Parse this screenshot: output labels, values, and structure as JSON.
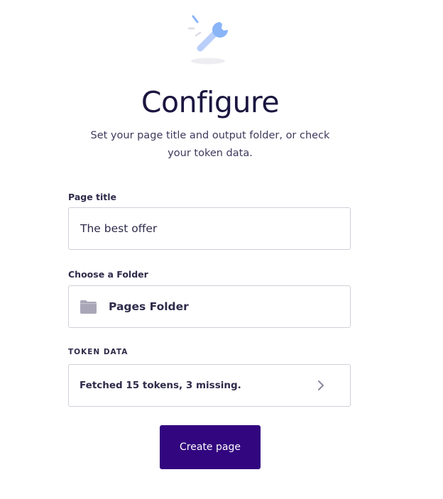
{
  "header": {
    "icon": "wrench-icon",
    "title": "Configure",
    "subtitle": "Set your page title and output folder, or check your token data."
  },
  "page_title_field": {
    "label": "Page title",
    "value": "The best offer"
  },
  "folder_field": {
    "label": "Choose a Folder",
    "icon": "folder-icon",
    "value": "Pages Folder"
  },
  "token_data": {
    "label": "TOKEN DATA",
    "status": "Fetched 15 tokens, 3 missing.",
    "icon": "chevron-right-icon"
  },
  "actions": {
    "create_label": "Create page"
  },
  "colors": {
    "primary": "#32067f",
    "heading": "#1b1640",
    "icon_accent": "#8ab4f8",
    "icon_muted": "#a9a7b7"
  }
}
